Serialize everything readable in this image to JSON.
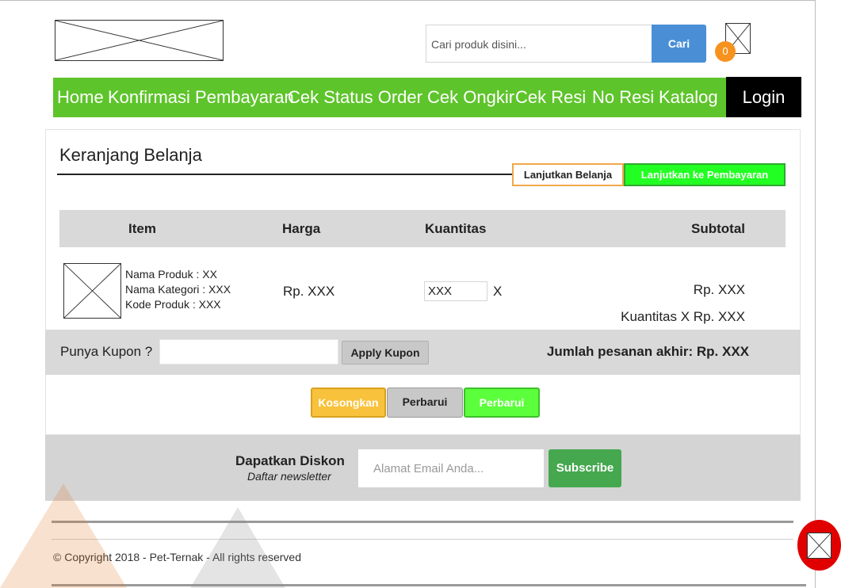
{
  "header": {
    "search_placeholder": "Cari produk disini...",
    "search_button": "Cari",
    "cart_count": "0"
  },
  "nav": {
    "items": [
      "Home",
      "Konfirmasi Pembayaran",
      "Cek Status Order",
      "Cek Ongkir",
      "Cek Resi",
      "No Resi",
      "Katalog"
    ],
    "login": "Login"
  },
  "cart": {
    "title": "Keranjang Belanja",
    "continue_shopping": "Lanjutkan Belanja",
    "checkout": "Lanjutkan ke Pembayaran",
    "columns": [
      "Item",
      "Harga",
      "Kuantitas",
      "Subtotal"
    ],
    "product": {
      "name": "Nama Produk : XX",
      "category": "Nama Kategori : XXX",
      "code": "Kode Produk : XXX",
      "price": "Rp. XXX",
      "quantity": "XXX",
      "x_label": "X",
      "subtotal": "Rp. XXX",
      "subtotal_formula": "Kuantitas X Rp. XXX"
    },
    "coupon_label": "Punya Kupon ?",
    "apply_coupon": "Apply Kupon",
    "total": "Jumlah pesanan akhir: Rp. XXX",
    "actions": {
      "empty": "Kosongkan",
      "update_gray": "Perbarui",
      "update_green": "Perbarui"
    }
  },
  "newsletter": {
    "title": "Dapatkan Diskon",
    "subtitle": "Daftar newsletter",
    "email_placeholder": "Alamat Email Anda...",
    "subscribe": "Subscribe"
  },
  "footer": {
    "copyright": "© Copyright 2018 - Pet-Ternak - All rights reserved"
  },
  "colors": {
    "nav_green": "#5ec42b",
    "checkout_green": "#22ff22",
    "search_blue": "#4a8fd6",
    "badge_orange": "#f7921e",
    "subscribe_green": "#45a84f",
    "empty_yellow": "#f9c23c",
    "scroll_top_red": "#e00000"
  }
}
